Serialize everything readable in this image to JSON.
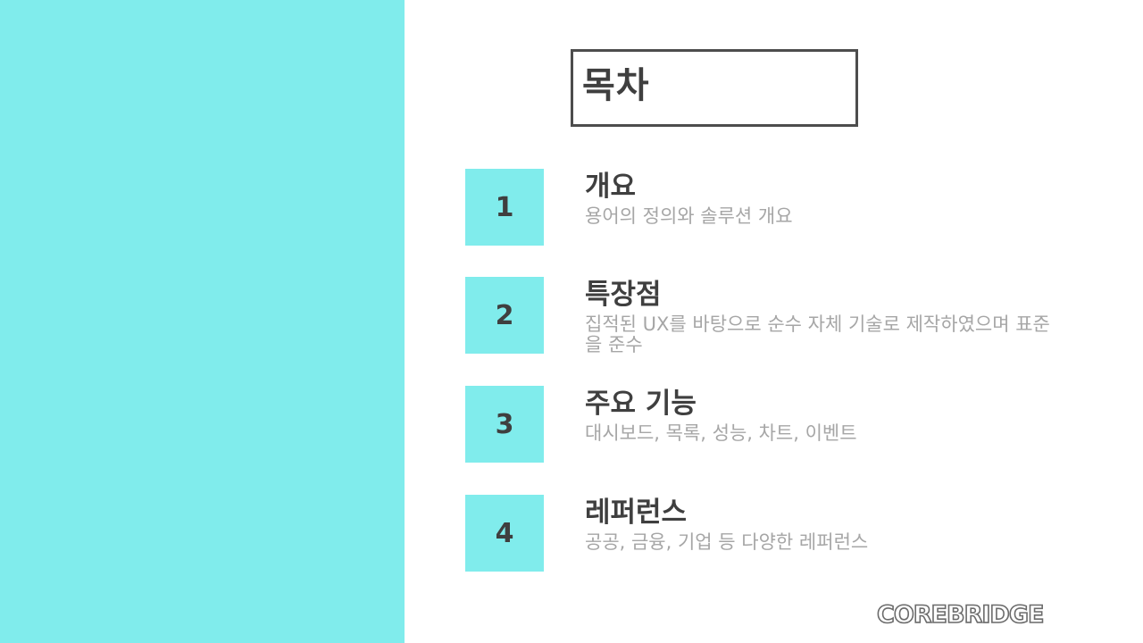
{
  "slide": {
    "title": "목차",
    "items": [
      {
        "number": "1",
        "title": "개요",
        "description": "용어의 정의와 솔루션 개요"
      },
      {
        "number": "2",
        "title": "특장점",
        "description": "집적된 UX를 바탕으로 순수 자체 기술로 제작하였으며 표준을 준수"
      },
      {
        "number": "3",
        "title": "주요 기능",
        "description": "대시보드, 목록, 성능, 차트, 이벤트"
      },
      {
        "number": "4",
        "title": "레퍼런스",
        "description": "공공, 금융, 기업 등 다양한 레퍼런스"
      }
    ],
    "logo": "COREBRIDGE"
  },
  "colors": {
    "accent": "#80ecec",
    "title_text": "#3f3f3f",
    "description_text": "#a6a6a6",
    "border": "#4d4d4d"
  }
}
